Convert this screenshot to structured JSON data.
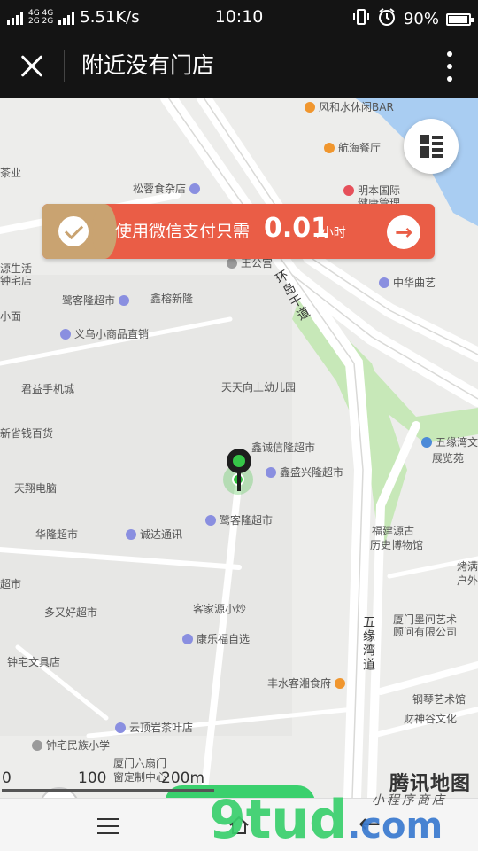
{
  "status_bar": {
    "network_top": "4G 4G",
    "network_bottom": "2G 2G",
    "speed": "5.51K/s",
    "time": "10:10",
    "battery": "90%",
    "battery_level": 0.9
  },
  "title_bar": {
    "title": "附近没有门店"
  },
  "promo": {
    "text": "使用微信支付只需",
    "price": "0.01",
    "unit": "/小时"
  },
  "map": {
    "pois": [
      {
        "label": "风和水休闲BAR",
        "color": "#f0962e"
      },
      {
        "label": "航海餐厅",
        "color": "#f0962e"
      },
      {
        "label": "茶业",
        "color": "#8a8fe0"
      },
      {
        "label": "松蓉食杂店",
        "color": "#8a8fe0"
      },
      {
        "label": "明本国际",
        "color": "#e6505a"
      },
      {
        "label": "健康管理",
        "color": "#e6505a"
      },
      {
        "label": "王公宫",
        "color": "#9a9a9a"
      },
      {
        "label": "源生活",
        "color": "#8a8fe0"
      },
      {
        "label": "钟宅店",
        "color": "#8a8fe0"
      },
      {
        "label": "鹭客隆超市",
        "color": "#8a8fe0"
      },
      {
        "label": "鑫榕新隆",
        "color": "#8a8fe0"
      },
      {
        "label": "中华曲艺",
        "color": "#8a8fe0"
      },
      {
        "label": "小面",
        "color": "#8a8fe0"
      },
      {
        "label": "义乌小商品直销",
        "color": "#8a8fe0"
      },
      {
        "label": "君益手机城",
        "color": "#8a8fe0"
      },
      {
        "label": "天天向上幼儿园",
        "color": "#9a9a9a"
      },
      {
        "label": "新省钱百货",
        "color": "#8a8fe0"
      },
      {
        "label": "鑫诚信隆超市",
        "color": "#8a8fe0"
      },
      {
        "label": "五缘湾文化",
        "color": "#4c8ad8"
      },
      {
        "label": "展览苑",
        "color": "#4c8ad8"
      },
      {
        "label": "鑫盛兴隆超市",
        "color": "#8a8fe0"
      },
      {
        "label": "天翔电脑",
        "color": "#8a8fe0"
      },
      {
        "label": "鹭客隆超市",
        "color": "#8a8fe0"
      },
      {
        "label": "华隆超市",
        "color": "#8a8fe0"
      },
      {
        "label": "诚达通讯",
        "color": "#8a8fe0"
      },
      {
        "label": "福建源古",
        "color": "#9a9a9a"
      },
      {
        "label": "历史博物馆",
        "color": "#9a9a9a"
      },
      {
        "label": "烤满",
        "color": "#9a9a9a"
      },
      {
        "label": "户外",
        "color": "#9a9a9a"
      },
      {
        "label": "超市",
        "color": "#8a8fe0"
      },
      {
        "label": "客家源小炒",
        "color": "#f0962e"
      },
      {
        "label": "多又好超市",
        "color": "#8a8fe0"
      },
      {
        "label": "厦门墨问艺术",
        "color": "#9a9a9a"
      },
      {
        "label": "顾问有限公司",
        "color": "#9a9a9a"
      },
      {
        "label": "康乐福自选",
        "color": "#8a8fe0"
      },
      {
        "label": "钟宅文具店",
        "color": "#8a8fe0"
      },
      {
        "label": "丰水客湘食府",
        "color": "#f0962e"
      },
      {
        "label": "钢琴艺术馆",
        "color": "#9a9a9a"
      },
      {
        "label": "财神谷文化",
        "color": "#9a9a9a"
      },
      {
        "label": "钟宅民族小学",
        "color": "#9a9a9a"
      },
      {
        "label": "云顶岩茶叶店",
        "color": "#8a8fe0"
      },
      {
        "label": "厦门六扇门",
        "color": "#9a9a9a"
      },
      {
        "label": "窗定制中心",
        "color": "#9a9a9a"
      }
    ],
    "roads": {
      "ring_road": "环岛干道",
      "wuyuan_road": "五缘湾道"
    },
    "scale": {
      "left": "0",
      "mid": "100",
      "right": "200m"
    },
    "logo": "腾讯地图"
  },
  "watermark": {
    "main": "9tud",
    "suffix": ".com",
    "sub": "小程序商店"
  }
}
